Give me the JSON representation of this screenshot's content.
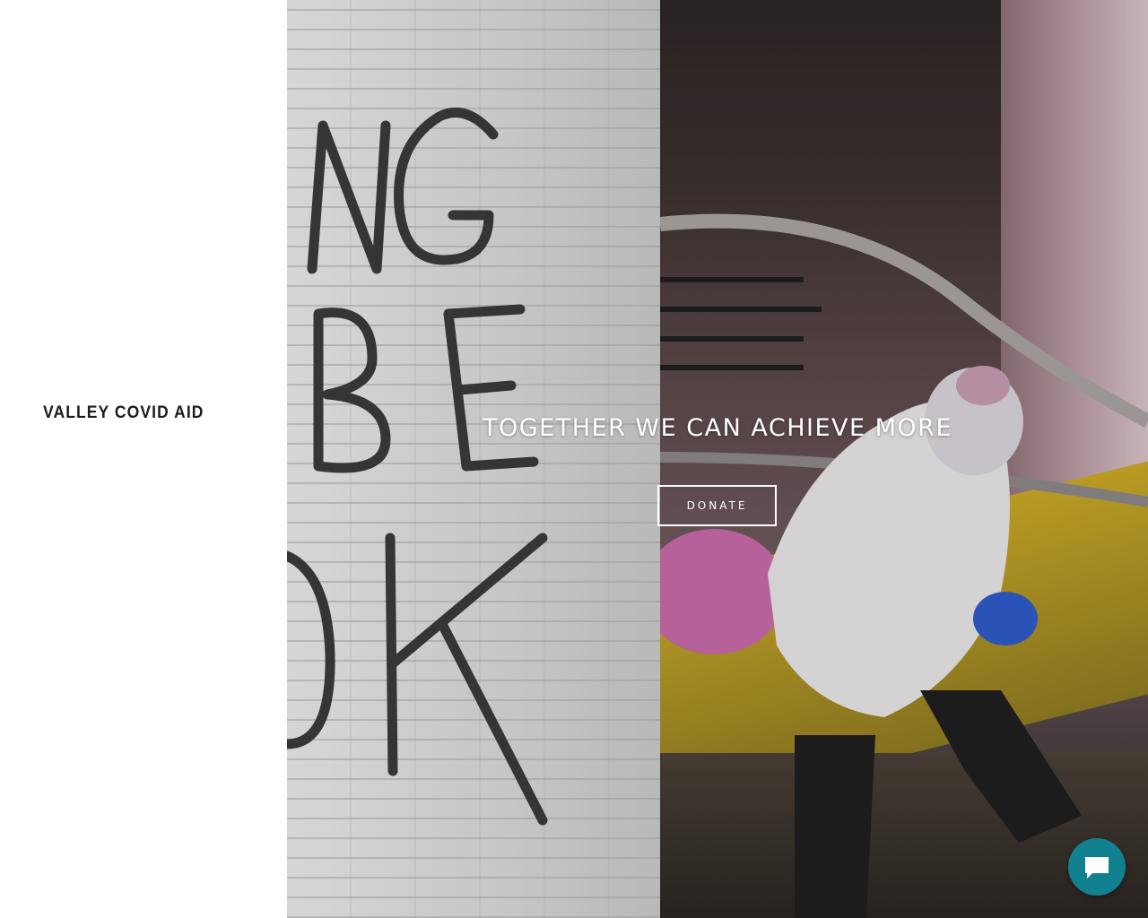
{
  "site": {
    "brand": "VALLEY COVID AID"
  },
  "hero": {
    "headline": "TOGETHER WE CAN ACHIEVE MORE",
    "donate_label": "DONATE",
    "overlay_color": "#ffffff"
  },
  "chat": {
    "icon": "chat-bubble-icon",
    "color": "#11808f"
  }
}
